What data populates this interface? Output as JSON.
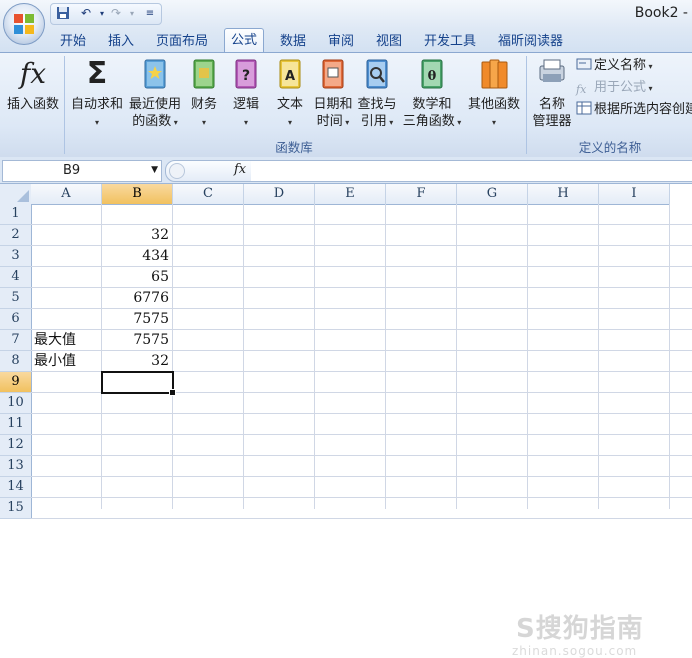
{
  "app": {
    "title": "Book2 -"
  },
  "qat": {
    "save_icon": "save-icon",
    "undo_icon": "undo-icon",
    "redo_icon": "redo-icon",
    "customize_icon": "customize-icon"
  },
  "tabs": [
    {
      "label": "开始"
    },
    {
      "label": "插入"
    },
    {
      "label": "页面布局"
    },
    {
      "label": "公式",
      "active": true
    },
    {
      "label": "数据"
    },
    {
      "label": "审阅"
    },
    {
      "label": "视图"
    },
    {
      "label": "开发工具"
    },
    {
      "label": "福昕阅读器"
    }
  ],
  "ribbon": {
    "function_library": {
      "label": "函数库",
      "insert_function": "插入函数",
      "autosum_line1": "自动求和",
      "recent_line1": "最近使用",
      "recent_line2": "的函数",
      "financial": "财务",
      "logical": "逻辑",
      "text": "文本",
      "datetime_line1": "日期和",
      "datetime_line2": "时间",
      "lookup_line1": "查找与",
      "lookup_line2": "引用",
      "math_line1": "数学和",
      "math_line2": "三角函数",
      "more_functions": "其他函数"
    },
    "defined_names": {
      "label": "定义的名称",
      "name_manager_line1": "名称",
      "name_manager_line2": "管理器",
      "define_name": "定义名称",
      "use_in_formula": "用于公式",
      "create_from_selection": "根据所选内容创建"
    }
  },
  "formula_bar": {
    "name_box": "B9",
    "fx_label": "fx",
    "formula": ""
  },
  "sheet": {
    "columns": [
      "A",
      "B",
      "C",
      "D",
      "E",
      "F",
      "G",
      "H",
      "I"
    ],
    "rows": [
      "1",
      "2",
      "3",
      "4",
      "5",
      "6",
      "7",
      "8",
      "9",
      "10",
      "11",
      "12",
      "13",
      "14",
      "15"
    ],
    "selected_cell": "B9",
    "cells": {
      "B2": "32",
      "B3": "434",
      "B4": "65",
      "B5": "6776",
      "B6": "7575",
      "A7": "最大值",
      "B7": "7575",
      "A8": "最小值",
      "B8": "32"
    }
  },
  "watermark": {
    "main": "S搜狗指南",
    "sub": "zhinan.sogou.com"
  },
  "colors": {
    "ribbon_bg": "#dde8f6",
    "tab_text": "#15428b",
    "header_selected": "#f1c15f",
    "grid_line": "#d0d7e5"
  }
}
